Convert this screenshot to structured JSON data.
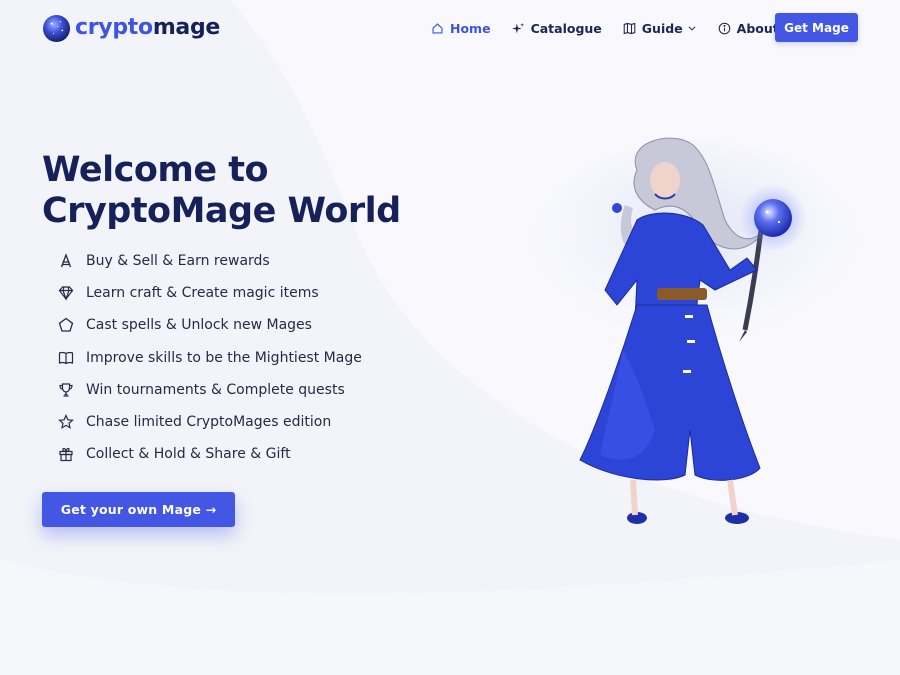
{
  "brand": {
    "name_part1": "crypto",
    "name_part2": "mage"
  },
  "nav": {
    "items": [
      {
        "label": "Home",
        "icon": "home-icon",
        "active": true
      },
      {
        "label": "Catalogue",
        "icon": "sparkle-icon",
        "active": false
      },
      {
        "label": "Guide",
        "icon": "map-icon",
        "active": false,
        "has_dropdown": true
      },
      {
        "label": "About Us",
        "icon": "info-icon",
        "active": false
      }
    ],
    "cta_label": "Get Mage"
  },
  "hero": {
    "title": "Welcome to CryptoMage World",
    "features": [
      {
        "text": "Buy & Sell & Earn rewards",
        "icon": "cardano-icon"
      },
      {
        "text": "Learn craft & Create magic items",
        "icon": "diamond-icon"
      },
      {
        "text": "Cast spells & Unlock new Mages",
        "icon": "pentagon-icon"
      },
      {
        "text": "Improve skills to be the Mightiest Mage",
        "icon": "book-icon"
      },
      {
        "text": "Win tournaments & Complete quests",
        "icon": "trophy-icon"
      },
      {
        "text": "Chase limited CryptoMages edition",
        "icon": "star-icon"
      },
      {
        "text": "Collect & Hold & Share & Gift",
        "icon": "gift-icon"
      }
    ],
    "cta_label": "Get your own Mage →"
  },
  "colors": {
    "accent": "#4356e4",
    "heading": "#16215a",
    "background": "#f3f4f9",
    "robe": "#2d45d6"
  }
}
